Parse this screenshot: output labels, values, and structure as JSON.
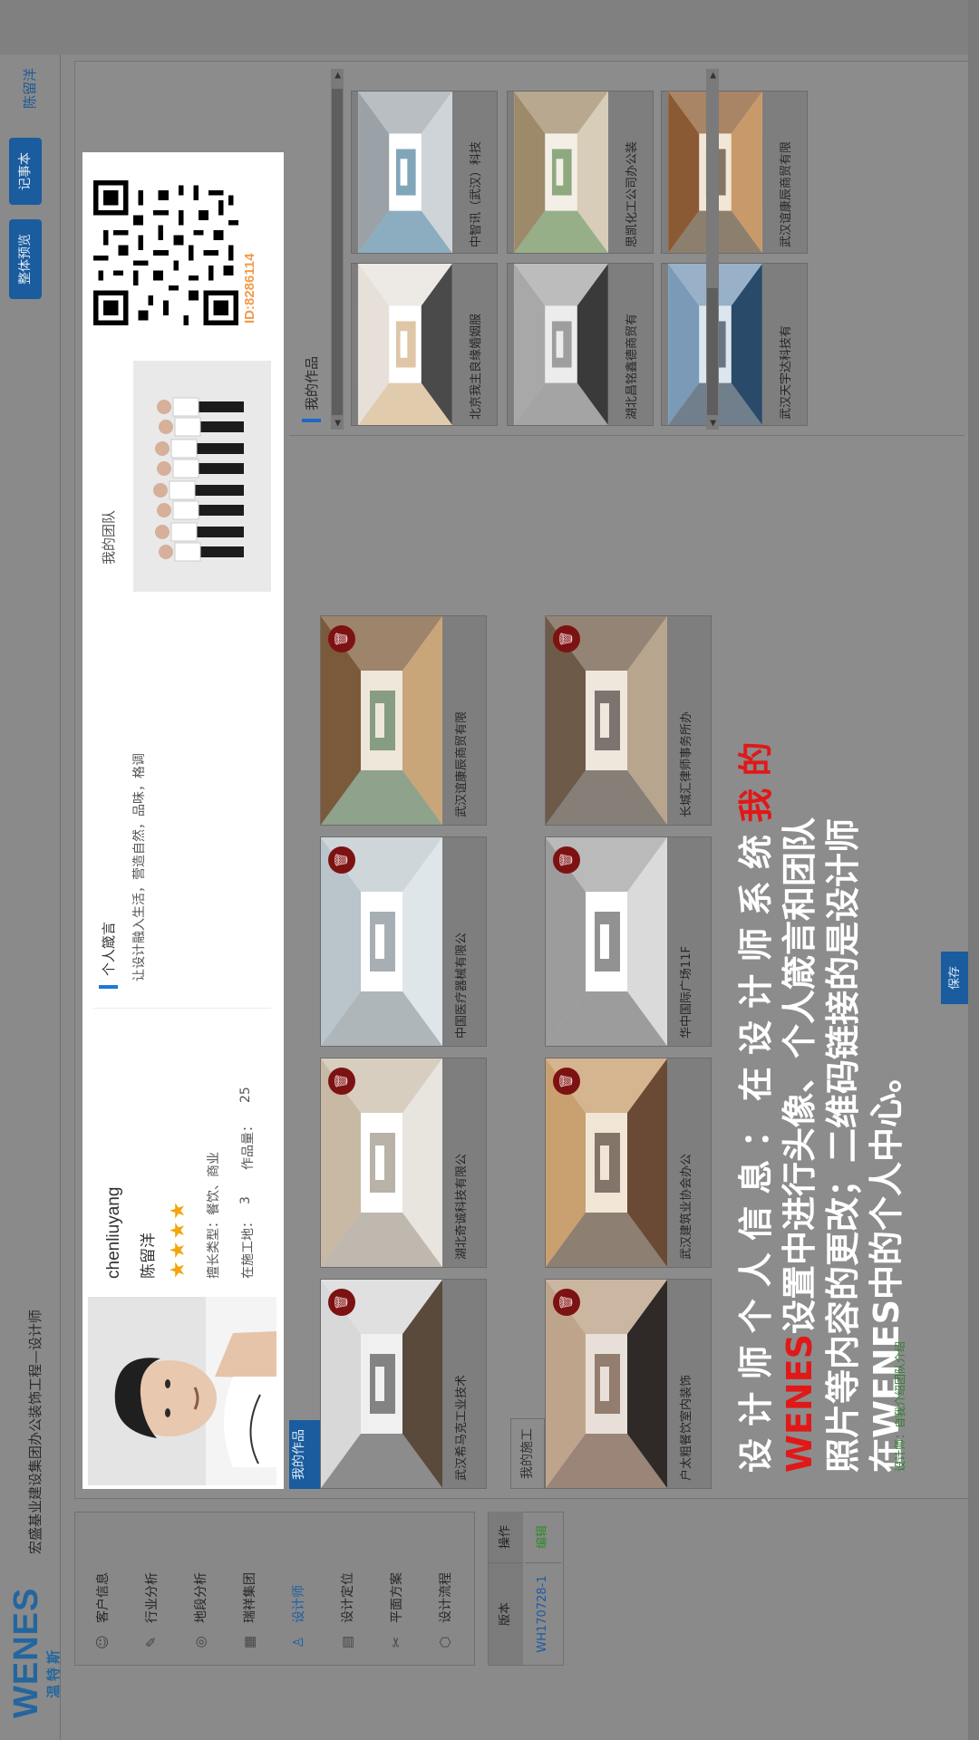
{
  "header": {
    "logo_text": "WENES",
    "logo_cn": "温特斯",
    "breadcrumb": "宏盛基业建设集团办公装饰工程—设计师",
    "preview_label": "整体预览",
    "notebook_label": "记事本",
    "username": "陈留洋"
  },
  "sidebar": {
    "items": [
      {
        "label": "客户信息",
        "icon": "customer-icon"
      },
      {
        "label": "行业分析",
        "icon": "analysis-icon"
      },
      {
        "label": "地段分析",
        "icon": "location-icon"
      },
      {
        "label": "瑞祥集团",
        "icon": "building-icon"
      },
      {
        "label": "设计师",
        "icon": "designer-icon"
      },
      {
        "label": "设计定位",
        "icon": "document-icon"
      },
      {
        "label": "平面方案",
        "icon": "tools-icon"
      },
      {
        "label": "设计流程",
        "icon": "flow-icon"
      }
    ],
    "active_index": 4
  },
  "version_table": {
    "headers": [
      "版本",
      "操作"
    ],
    "rows": [
      {
        "version": "WH170728-1",
        "action": "编辑"
      }
    ]
  },
  "profile": {
    "name_en": "chenliuyang",
    "name_cn": "陈留洋",
    "rating": 4,
    "specialty": "擅长类型：餐饮、商业",
    "sites_label": "在施工地：",
    "sites_count": "3",
    "works_label": "作品量：",
    "works_count": "25",
    "motto_title": "个人箴言",
    "motto": "让设计融入生活，营造自然，品味，格调",
    "team_label": "我的团队",
    "id_text": "ID:8286114"
  },
  "tabs": {
    "works": "我的作品",
    "site": "我的施工"
  },
  "cards": [
    {
      "title": "武汉希马克工业技术"
    },
    {
      "title": "湖北奇诚科技有限公"
    },
    {
      "title": "中国医疗器械有限公"
    },
    {
      "title": "武汉谊康辰商贸有限"
    },
    {
      "title": "户太粗餐饮室内装饰"
    },
    {
      "title": "武汉建筑业协会办公"
    },
    {
      "title": "华中国际广场11F"
    },
    {
      "title": "长城汇律师事务所办"
    }
  ],
  "delete_icon": "trash-icon",
  "works_panel": {
    "title": "我的作品",
    "items": [
      {
        "title": "北京我主良缘婚姻服"
      },
      {
        "title": "中智讯（武汉）科技"
      },
      {
        "title": "湖北昌铭鑫德商贸有"
      },
      {
        "title": "思凯化工公司办公装"
      },
      {
        "title": "武汉天宇达科技有"
      },
      {
        "title": "武汉谊康辰商贸有限"
      }
    ]
  },
  "overlay": {
    "line1_a": "设 计 师 个 人 信 息 ： 在 设 计 师 系 统 ",
    "line1_b": "我 的",
    "line2_a": "WENES",
    "line2_b": "设置中进行头像、个人箴言和团队",
    "line3": "照片等内容的更改；二维码链接的是设计师",
    "line4": "在WENES中的个人中心。"
  },
  "tip": "设计师：自我介绍团队介绍",
  "confirm_label": "保存",
  "colors": {
    "brand_blue": "#1a5c9e",
    "accent_orange": "#f39b4a",
    "overlay_red": "#e11818",
    "star": "#f2a50c"
  }
}
